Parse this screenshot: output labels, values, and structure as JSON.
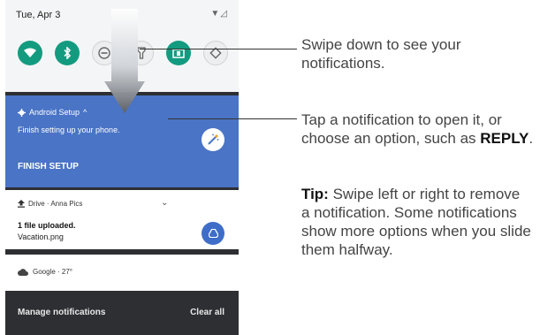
{
  "status_bar": {
    "date": "Tue, Apr 3",
    "icons": "wifi-signal, battery"
  },
  "quick_settings": [
    {
      "icon": "wifi-icon",
      "active": true
    },
    {
      "icon": "bluetooth-icon",
      "active": true
    },
    {
      "icon": "do-not-disturb-icon",
      "active": false
    },
    {
      "icon": "flashlight-icon",
      "active": false
    },
    {
      "icon": "cast-icon",
      "active": true
    },
    {
      "icon": "auto-rotate-icon",
      "active": false
    }
  ],
  "notifications": {
    "setup": {
      "app": "Android Setup",
      "expand_glyph": "^",
      "text": "Finish setting up your phone.",
      "action": "FINISH SETUP",
      "color": "#4a74c5"
    },
    "drive": {
      "app": "Drive · Anna Pics",
      "title": "1 file uploaded.",
      "subtitle": "Vacation.png"
    },
    "weather": {
      "app": "Google · 27°"
    }
  },
  "footer": {
    "manage": "Manage notifications",
    "clear": "Clear all"
  },
  "callouts": {
    "swipe": "Swipe down to see your notifications.",
    "tap_prefix": "Tap a notification to open it, or choose an option, such as",
    "tap_keyword": "REPLY",
    "tap_suffix": ".",
    "tip_label": "Tip:",
    "tip_text": "Swipe left or right to remove a notification. Some notifications show more options when you slide them halfway."
  }
}
